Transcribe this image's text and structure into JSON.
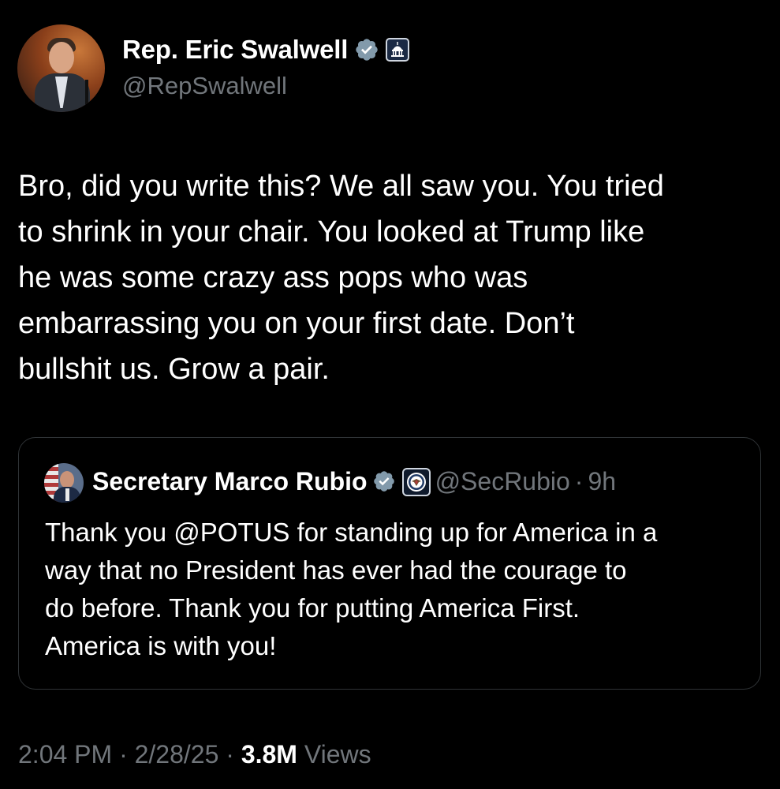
{
  "author": {
    "display_name": "Rep. Eric Swalwell",
    "handle": "@RepSwalwell",
    "verified_icon": "verified-check-icon",
    "affiliation_icon": "capitol-badge-icon"
  },
  "tweet": {
    "lines": [
      "Bro, did you write this? We all saw you. You tried",
      "to shrink in your chair. You looked at Trump like",
      "he was some crazy ass pops who was",
      "embarrassing you on your first date. Don’t",
      "bullshit us. Grow a pair."
    ]
  },
  "quote": {
    "display_name": "Secretary Marco Rubio",
    "handle": "@SecRubio",
    "separator": "·",
    "time": "9h",
    "verified_icon": "verified-check-icon",
    "affiliation_icon": "state-department-seal-icon",
    "lines": [
      "Thank you @POTUS for standing up for America in a",
      "way that no President has ever had the courage to",
      "do before. Thank you for putting America First.",
      "America is with you!"
    ]
  },
  "meta": {
    "time": "2:04 PM",
    "sep1": " · ",
    "date": "2/28/25",
    "sep2": " · ",
    "views_count": "3.8M",
    "views_label": " Views"
  },
  "colors": {
    "background": "#000000",
    "primary_text": "#ffffff",
    "secondary_text": "#71767b",
    "verified_blue": "#1d9bf0",
    "border": "#2f3336"
  }
}
